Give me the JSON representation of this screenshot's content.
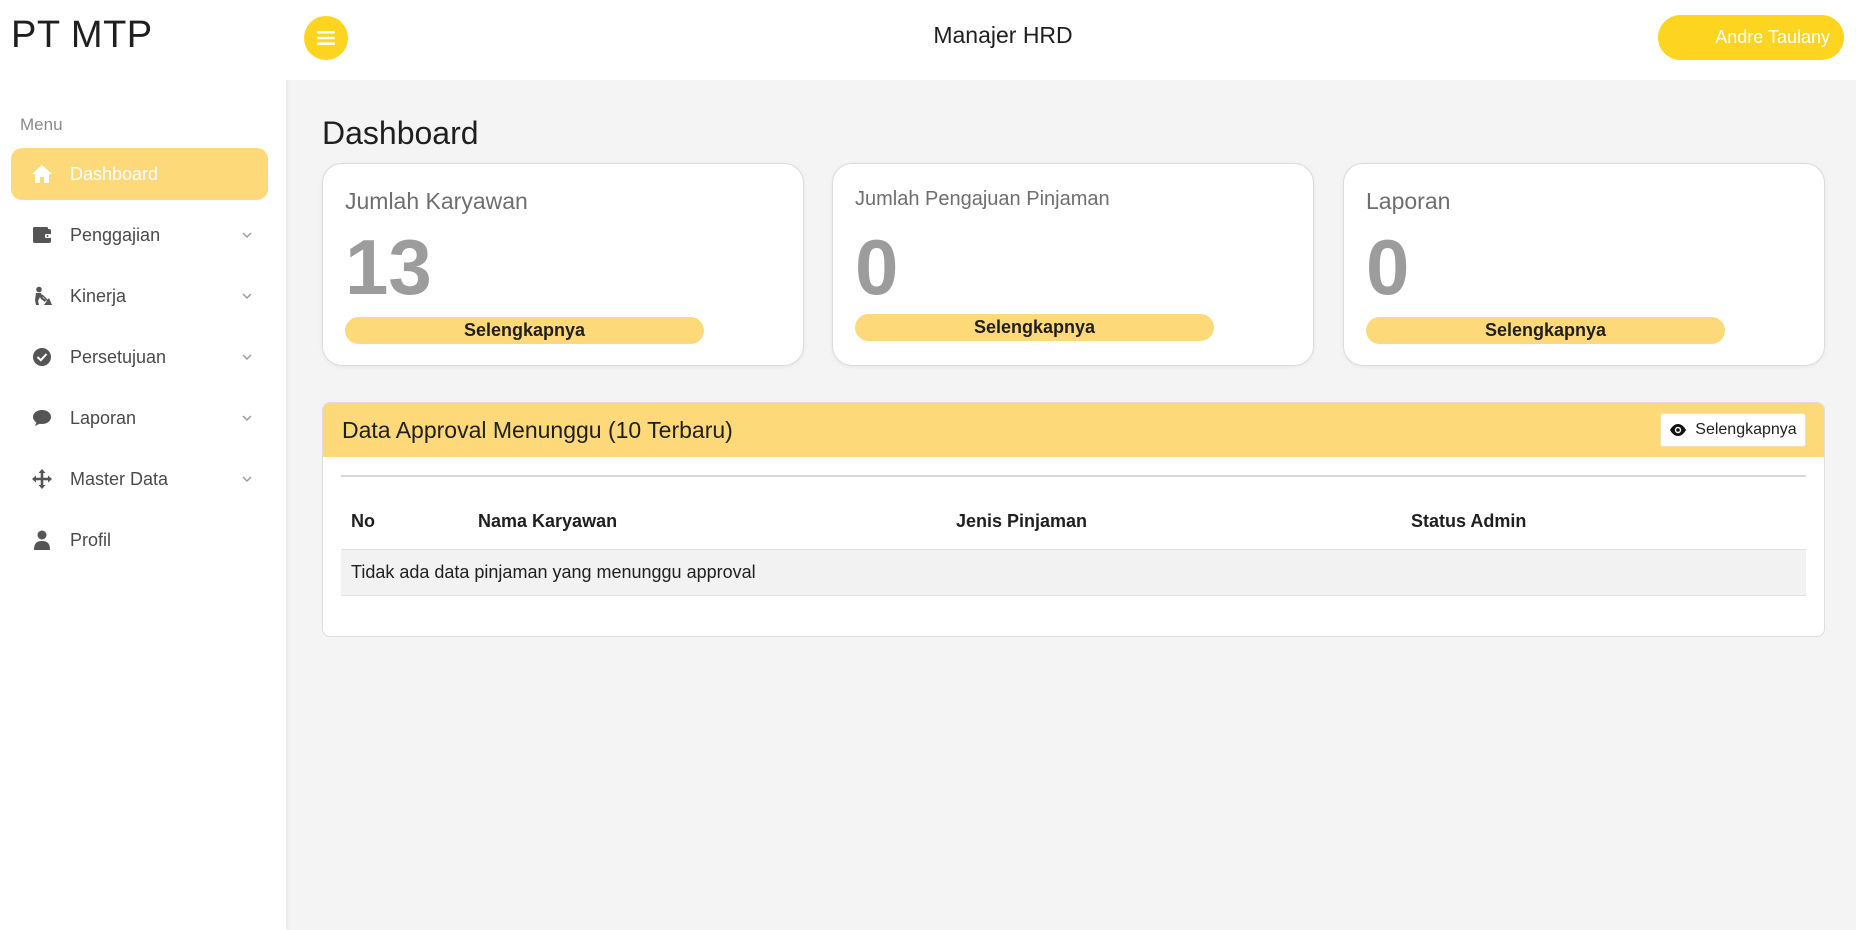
{
  "sidebar": {
    "brand": "PT MTP",
    "menu_label": "Menu",
    "items": [
      {
        "label": "Dashboard",
        "icon": "home-icon",
        "active": true,
        "has_submenu": false
      },
      {
        "label": "Penggajian",
        "icon": "wallet-icon",
        "active": false,
        "has_submenu": true
      },
      {
        "label": "Kinerja",
        "icon": "person-digging-icon",
        "active": false,
        "has_submenu": true
      },
      {
        "label": "Persetujuan",
        "icon": "check-circle-icon",
        "active": false,
        "has_submenu": true
      },
      {
        "label": "Laporan",
        "icon": "comment-icon",
        "active": false,
        "has_submenu": true
      },
      {
        "label": "Master Data",
        "icon": "arrows-move-icon",
        "active": false,
        "has_submenu": true
      },
      {
        "label": "Profil",
        "icon": "user-icon",
        "active": false,
        "has_submenu": false
      }
    ]
  },
  "header": {
    "menu_button_icon": "hamburger-icon",
    "role_title": "Manajer HRD",
    "user_name": "Andre Taulany"
  },
  "main": {
    "page_title": "Dashboard",
    "cards": [
      {
        "title": "Jumlah Karyawan",
        "value": "13",
        "button": "Selengkapnya"
      },
      {
        "title": "Jumlah Pengajuan Pinjaman",
        "value": "0",
        "button": "Selengkapnya"
      },
      {
        "title": "Laporan",
        "value": "0",
        "button": "Selengkapnya"
      }
    ],
    "approval_panel": {
      "title": "Data Approval Menunggu (10 Terbaru)",
      "button": "Selengkapnya",
      "button_icon": "eye-icon",
      "columns": [
        "No",
        "Nama Karyawan",
        "Jenis Pinjaman",
        "Status Admin"
      ],
      "empty_message": "Tidak ada data pinjaman yang menunggu approval"
    }
  },
  "colors": {
    "accent": "#fdd41f",
    "accent_soft": "#fdd97a",
    "background": "#f4f4f4"
  }
}
